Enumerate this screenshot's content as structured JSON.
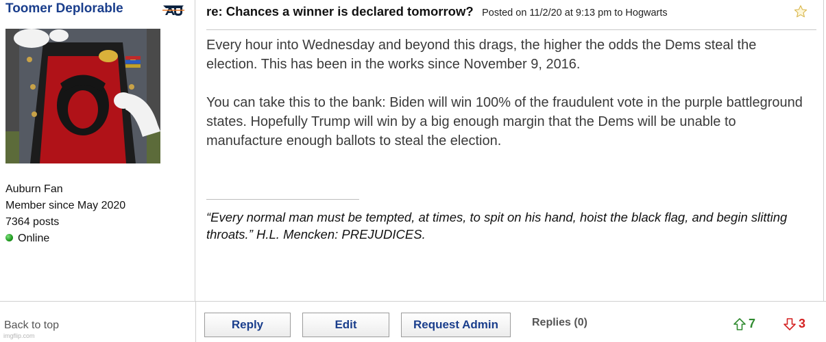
{
  "user": {
    "name": "Toomer Deplorable",
    "team_logo_icon": "auburn-au-logo-icon",
    "avatar_icon": "user-avatar-image",
    "fan_of": "Auburn Fan",
    "member_since": "Member since May 2020",
    "posts": "7364 posts",
    "status": "Online"
  },
  "post": {
    "title": "re: Chances a winner is declared tomorrow?",
    "meta": "Posted on 11/2/20 at 9:13 pm to Hogwarts",
    "star_icon": "star-outline-icon",
    "paragraphs": [
      "Every hour into Wednesday and beyond this drags, the higher the odds the Dems steal the election. This has been in the works since November 9, 2016.",
      "You can take this to the bank: Biden will win 100% of the fraudulent vote in the purple battleground states. Hopefully Trump will win by a big enough margin that the Dems will be unable to manufacture enough ballots to steal the election."
    ],
    "signature": "“Every normal man must be tempted, at times, to spit on his hand, hoist the black flag, and begin slitting throats.” H.L. Mencken: PREJUDICES."
  },
  "footer": {
    "back_to_top": "Back to top",
    "reply_label": "Reply",
    "edit_label": "Edit",
    "request_admin_label": "Request Admin",
    "replies_label": "Replies (0)",
    "upvotes": "7",
    "downvotes": "3",
    "upvote_icon": "arrow-up-outline-icon",
    "downvote_icon": "arrow-down-outline-icon"
  },
  "watermark": "imgflip.com",
  "colors": {
    "username": "#1a3e8c",
    "button_text": "#1a3e8c",
    "upvote": "#2f8a2f",
    "downvote": "#d42020",
    "online": "#1f9a1f"
  }
}
